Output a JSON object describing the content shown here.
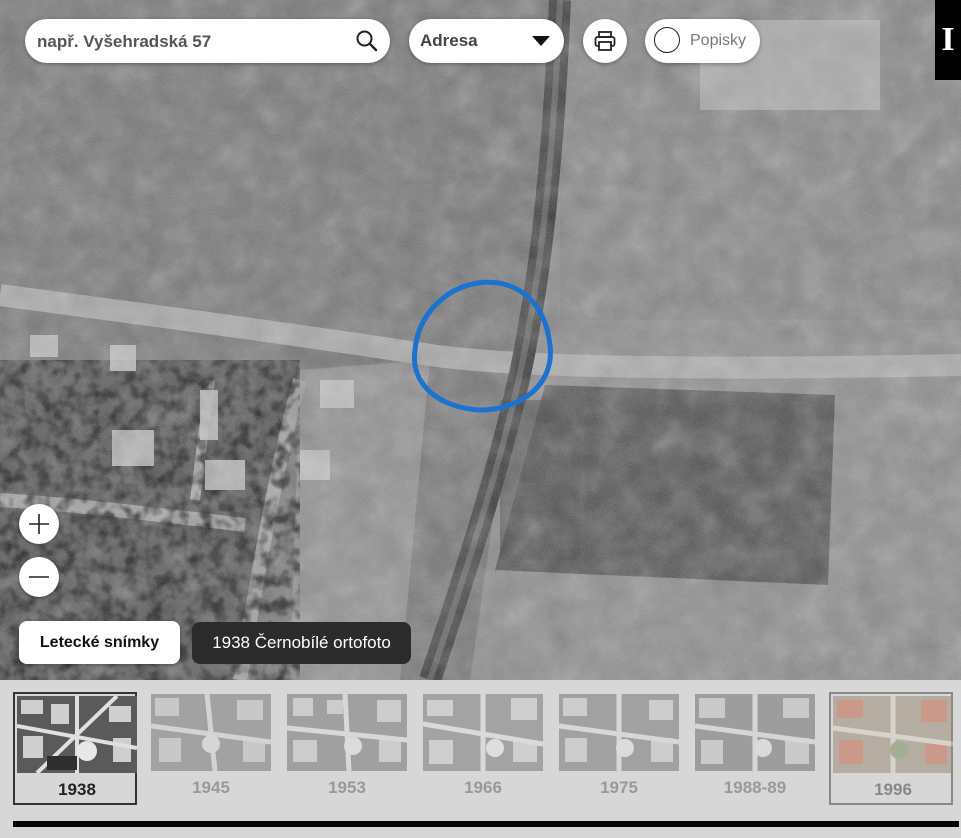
{
  "search": {
    "placeholder": "např. Vyšehradská 57"
  },
  "search_type": {
    "selected": "Adresa"
  },
  "labels_toggle": {
    "label": "Popisky",
    "checked": false
  },
  "info_button": {
    "symbol": "I"
  },
  "layer": {
    "button_label": "Letecké snímky",
    "current": "1938 Černobílé ortofoto"
  },
  "highlight_color": "#1a73d1",
  "timeline": {
    "items": [
      {
        "year": "1938",
        "state": "active"
      },
      {
        "year": "1945",
        "state": "inactive"
      },
      {
        "year": "1953",
        "state": "inactive"
      },
      {
        "year": "1966",
        "state": "inactive"
      },
      {
        "year": "1975",
        "state": "inactive"
      },
      {
        "year": "1988-89",
        "state": "inactive"
      },
      {
        "year": "1996",
        "state": "inactive-color"
      }
    ]
  }
}
